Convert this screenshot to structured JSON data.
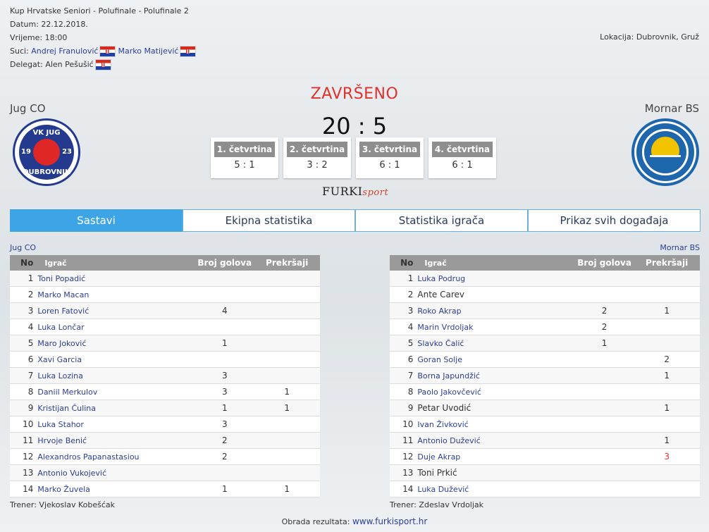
{
  "match": {
    "competition": "Kup Hrvatske Seniori - Polufinale - Polufinale 2",
    "date_label": "Datum: 22.12.2018.",
    "time_label": "Vrijeme: 18:00",
    "referees_label": "Suci:",
    "referee1": "Andrej Franulović",
    "referee2": "Marko Matijević",
    "delegate_label": "Delegat:",
    "delegate": "Alen Pešušić",
    "location": "Lokacija: Dubrovnik, Gruž",
    "status": "ZAVRŠENO",
    "score": "20 : 5"
  },
  "home": {
    "name": "Jug CO",
    "logo_top": "VK JUG",
    "logo_bottom": "DUBROVNIK",
    "logo_left": "19",
    "logo_right": "23"
  },
  "away": {
    "name": "Mornar BS",
    "logo_text": "V.K. MORNAR-BRODOSPLIT SPLIT-HRVATSKA"
  },
  "quarters": [
    {
      "label": "1. četvrtina",
      "score": "5 : 1"
    },
    {
      "label": "2. četvrtina",
      "score": "3 : 2"
    },
    {
      "label": "3. četvrtina",
      "score": "6 : 1"
    },
    {
      "label": "4. četvrtina",
      "score": "6 : 1"
    }
  ],
  "brand": {
    "main": "FURKI",
    "accent": "sport"
  },
  "tabs": [
    "Sastavi",
    "Ekipna statistika",
    "Statistika igrača",
    "Prikaz svih događaja"
  ],
  "columns": {
    "no": "No",
    "player": "Igrač",
    "goals": "Broj golova",
    "fouls": "Prekršaji"
  },
  "home_roster": {
    "title": "Jug CO",
    "coach": "Trener: Vjekoslav Kobešćak",
    "players": [
      {
        "no": "1",
        "name": "Toni Popadić",
        "goals": "",
        "fouls": ""
      },
      {
        "no": "2",
        "name": "Marko Macan",
        "goals": "",
        "fouls": ""
      },
      {
        "no": "3",
        "name": "Loren Fatović",
        "goals": "4",
        "fouls": ""
      },
      {
        "no": "4",
        "name": "Luka Lončar",
        "goals": "",
        "fouls": ""
      },
      {
        "no": "5",
        "name": "Maro Joković",
        "goals": "1",
        "fouls": ""
      },
      {
        "no": "6",
        "name": "Xavi Garcia",
        "goals": "",
        "fouls": ""
      },
      {
        "no": "7",
        "name": "Luka Lozina",
        "goals": "3",
        "fouls": ""
      },
      {
        "no": "8",
        "name": "Daniil Merkulov",
        "goals": "3",
        "fouls": "1"
      },
      {
        "no": "9",
        "name": "Kristijan Čulina",
        "goals": "1",
        "fouls": "1"
      },
      {
        "no": "10",
        "name": "Luka Stahor",
        "goals": "3",
        "fouls": ""
      },
      {
        "no": "11",
        "name": "Hrvoje Benić",
        "goals": "2",
        "fouls": ""
      },
      {
        "no": "12",
        "name": "Alexandros Papanastasiou",
        "goals": "2",
        "fouls": ""
      },
      {
        "no": "13",
        "name": "Antonio Vukojević",
        "goals": "",
        "fouls": ""
      },
      {
        "no": "14",
        "name": "Marko Žuvela",
        "goals": "1",
        "fouls": "1"
      }
    ]
  },
  "away_roster": {
    "title": "Mornar BS",
    "coach": "Trener: Zdeslav Vrdoljak",
    "players": [
      {
        "no": "1",
        "name": "Luka Podrug",
        "goals": "",
        "fouls": ""
      },
      {
        "no": "2",
        "name": "Ante Carev",
        "goals": "",
        "fouls": ""
      },
      {
        "no": "3",
        "name": "Roko Akrap",
        "goals": "2",
        "fouls": "1"
      },
      {
        "no": "4",
        "name": "Marin Vrdoljak",
        "goals": "2",
        "fouls": ""
      },
      {
        "no": "5",
        "name": "Slavko Čalić",
        "goals": "1",
        "fouls": ""
      },
      {
        "no": "6",
        "name": "Goran Solje",
        "goals": "",
        "fouls": "2"
      },
      {
        "no": "7",
        "name": "Borna Japundžić",
        "goals": "",
        "fouls": "1"
      },
      {
        "no": "8",
        "name": "Paolo Jakovčević",
        "goals": "",
        "fouls": ""
      },
      {
        "no": "9",
        "name": "Petar Uvodić",
        "goals": "",
        "fouls": "1"
      },
      {
        "no": "10",
        "name": "Ivan Živković",
        "goals": "",
        "fouls": ""
      },
      {
        "no": "11",
        "name": "Antonio Dužević",
        "goals": "",
        "fouls": "1"
      },
      {
        "no": "12",
        "name": "Duje Akrap",
        "goals": "",
        "fouls": "3"
      },
      {
        "no": "13",
        "name": "Toni Prkić",
        "goals": "",
        "fouls": ""
      },
      {
        "no": "14",
        "name": "Luka Dužević",
        "goals": "",
        "fouls": ""
      }
    ]
  },
  "footer": {
    "label": "Obrada rezultata:",
    "link": "www.furkisport.hr"
  }
}
